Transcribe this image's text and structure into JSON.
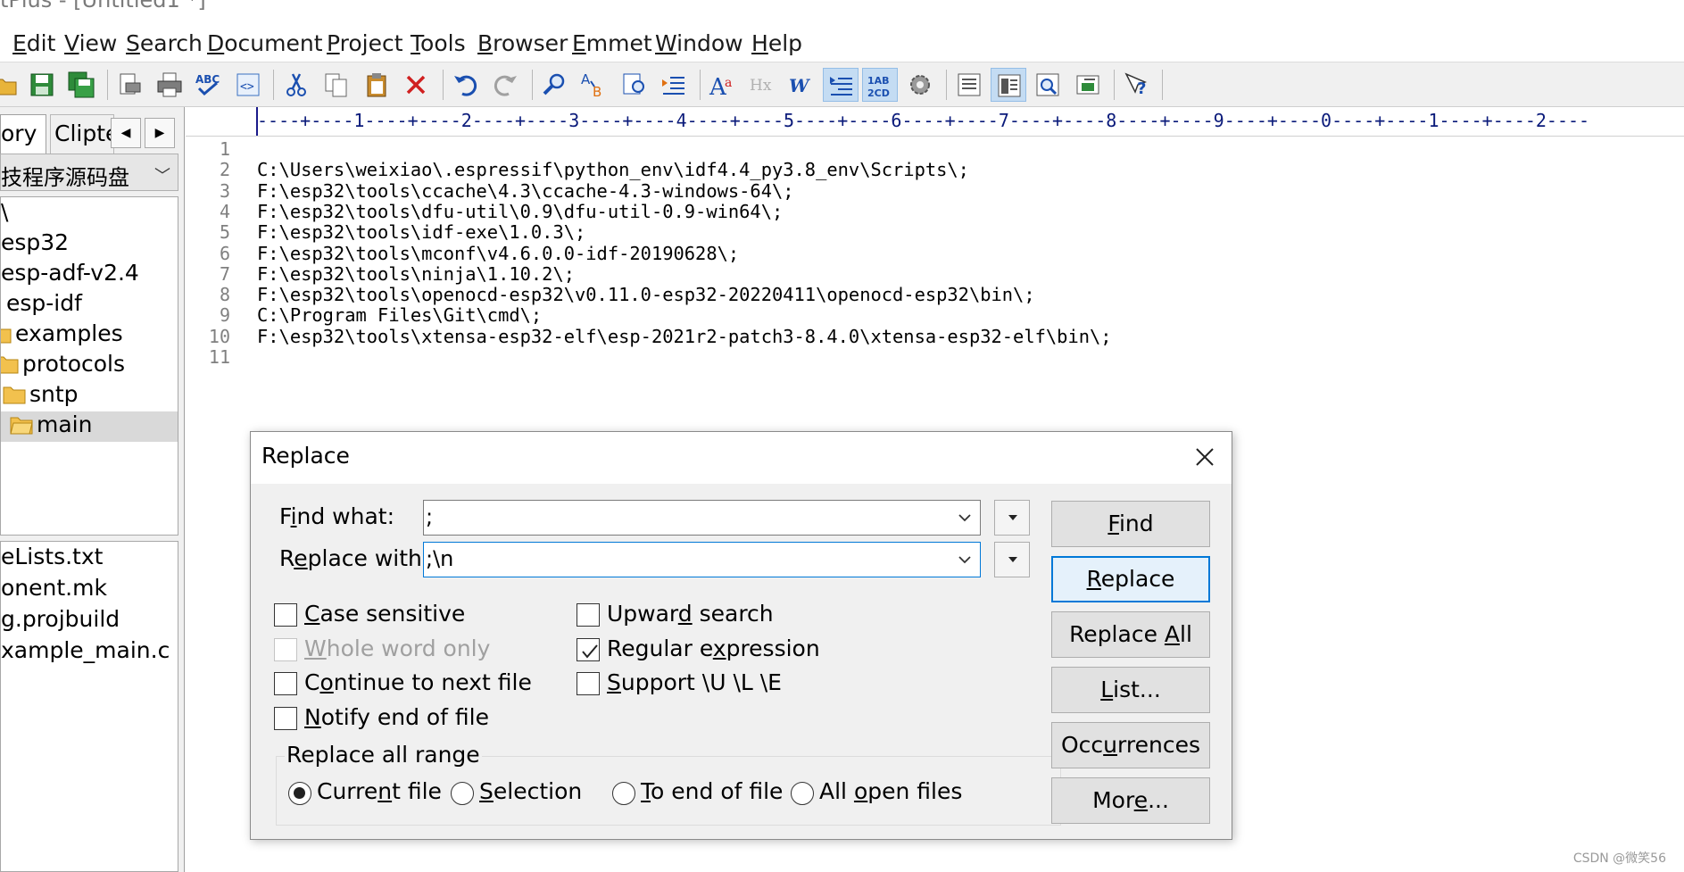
{
  "window": {
    "title": "tPlus - [Untitled1 *]"
  },
  "menu": [
    {
      "label": "Edit",
      "u": "E",
      "rest": "dit"
    },
    {
      "label": "View",
      "u": "V",
      "rest": "iew"
    },
    {
      "label": "Search",
      "u": "S",
      "rest": "earch"
    },
    {
      "label": "Document",
      "u": "D",
      "rest": "ocument"
    },
    {
      "label": "Project",
      "u": "P",
      "rest": "roject"
    },
    {
      "label": "Tools",
      "u": "T",
      "rest": "ools"
    },
    {
      "label": "Browser",
      "u": "B",
      "rest": "rowser"
    },
    {
      "label": "Emmet",
      "u": "E",
      "rest": "mmet"
    },
    {
      "label": "Window",
      "u": "W",
      "rest": "indow"
    },
    {
      "label": "Help",
      "u": "H",
      "rest": "elp"
    }
  ],
  "toolbar": {
    "icons": [
      "open-icon",
      "save-icon",
      "save-all-icon",
      "print-preview-icon",
      "print-icon",
      "spell-check-icon",
      "browser-view-icon",
      "cut-icon",
      "copy-icon",
      "paste-icon",
      "delete-icon",
      "undo-icon",
      "redo-icon",
      "find-icon",
      "replace-icon",
      "find-in-files-icon",
      "indent-icon",
      "font-icon",
      "hex-icon",
      "word-wrap-icon",
      "line-wrap-icon",
      "sort-icon",
      "settings-icon",
      "document-list-icon",
      "cliptext-icon",
      "directory-icon",
      "output-icon",
      "help-icon"
    ],
    "active": [
      "line-wrap-icon",
      "sort-icon",
      "cliptext-icon"
    ]
  },
  "left_panel": {
    "tab_directory": "ory",
    "tab_cliptext": "Clipte",
    "drive": "技程序源码盘",
    "folders": [
      {
        "label": "\\",
        "depth": 0,
        "folder": false,
        "selected": false
      },
      {
        "label": "esp32",
        "depth": 0,
        "folder": false,
        "selected": false
      },
      {
        "label": "esp-adf-v2.4",
        "depth": 0,
        "folder": false,
        "selected": false
      },
      {
        "label": "esp-idf",
        "depth": 1,
        "folder": false,
        "selected": false
      },
      {
        "label": "examples",
        "depth": 1,
        "folder": true,
        "selected": false
      },
      {
        "label": "protocols",
        "depth": 2,
        "folder": true,
        "selected": false
      },
      {
        "label": "sntp",
        "depth": 3,
        "folder": true,
        "selected": false
      },
      {
        "label": "main",
        "depth": 4,
        "folder": true,
        "selected": true
      }
    ],
    "files": [
      "eLists.txt",
      "onent.mk",
      "g.projbuild",
      "xample_main.c"
    ]
  },
  "editor": {
    "ruler": "----+----1----+----2----+----3----+----4----+----5----+----6----+----7----+----8----+----9----+----0----+----1----+----2----",
    "lines": [
      "",
      "C:\\Users\\weixiao\\.espressif\\python_env\\idf4.4_py3.8_env\\Scripts\\;",
      "F:\\esp32\\tools\\ccache\\4.3\\ccache-4.3-windows-64\\;",
      "F:\\esp32\\tools\\dfu-util\\0.9\\dfu-util-0.9-win64\\;",
      "F:\\esp32\\tools\\idf-exe\\1.0.3\\;",
      "F:\\esp32\\tools\\mconf\\v4.6.0.0-idf-20190628\\;",
      "F:\\esp32\\tools\\ninja\\1.10.2\\;",
      "F:\\esp32\\tools\\openocd-esp32\\v0.11.0-esp32-20220411\\openocd-esp32\\bin\\;",
      "C:\\Program Files\\Git\\cmd\\;",
      "F:\\esp32\\tools\\xtensa-esp32-elf\\esp-2021r2-patch3-8.4.0\\xtensa-esp32-elf\\bin\\;",
      ""
    ]
  },
  "dialog": {
    "title": "Replace",
    "find_label_pre": "F",
    "find_label_u": "i",
    "find_label_post": "nd what:",
    "find_value": ";",
    "replace_label_pre": "R",
    "replace_label_u": "e",
    "replace_label_post": "place with:",
    "replace_value": ";\\n",
    "options": [
      {
        "pre": "",
        "u": "C",
        "post": "ase sensitive",
        "checked": false,
        "disabled": false
      },
      {
        "pre": "",
        "u": "W",
        "post": "hole word only",
        "checked": false,
        "disabled": true
      },
      {
        "pre": "C",
        "u": "o",
        "post": "ntinue to next file",
        "checked": false,
        "disabled": false
      },
      {
        "pre": "",
        "u": "N",
        "post": "otify end of file",
        "checked": false,
        "disabled": false
      },
      {
        "pre": "Upwar",
        "u": "d",
        "post": " search",
        "checked": false,
        "disabled": false
      },
      {
        "pre": "Regular e",
        "u": "x",
        "post": "pression",
        "checked": true,
        "disabled": false
      },
      {
        "pre": "",
        "u": "S",
        "post": "upport \\U \\L \\E",
        "checked": false,
        "disabled": false
      }
    ],
    "range_label": "Replace all range",
    "ranges": [
      {
        "pre": "Curre",
        "u": "n",
        "post": "t file",
        "selected": true
      },
      {
        "pre": "",
        "u": "S",
        "post": "election",
        "selected": false
      },
      {
        "pre": "",
        "u": "T",
        "post": "o end of file",
        "selected": false
      },
      {
        "pre": "All ",
        "u": "o",
        "post": "pen files",
        "selected": false
      }
    ],
    "buttons": [
      {
        "pre": "",
        "u": "F",
        "post": "ind"
      },
      {
        "pre": "",
        "u": "R",
        "post": "eplace"
      },
      {
        "pre": "Replace ",
        "u": "A",
        "post": "ll"
      },
      {
        "pre": "",
        "u": "L",
        "post": "ist..."
      },
      {
        "pre": "Occ",
        "u": "u",
        "post": "rrences"
      },
      {
        "pre": "Mor",
        "u": "e",
        "post": "..."
      }
    ]
  },
  "watermark": "CSDN @微笑56",
  "colors": {
    "accent": "#0078d7",
    "toolbar_bg": "#f0f0f0",
    "selected_tree": "#d9d9d9"
  }
}
